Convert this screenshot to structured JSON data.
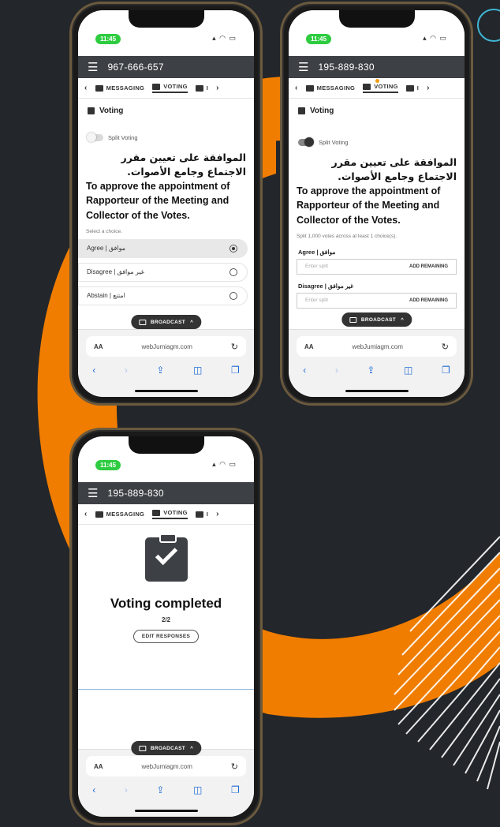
{
  "colors": {
    "background": "#23262a",
    "accent_orange": "#f07d00",
    "appbar": "#3d4145",
    "status_green": "#2ecc40"
  },
  "phones": [
    {
      "status_time": "11:45",
      "meeting_id": "967-666-657",
      "tabs": {
        "messaging": "MESSAGING",
        "voting": "VOTING",
        "docs": "I"
      },
      "section_title": "Voting",
      "split_voting": "Split Voting",
      "question_ar": "الموافقة على تعيين مقرر الاجتماع وجامع الأصوات.",
      "question_en": "To approve the appointment of Rapporteur of the Meeting and Collector of the Votes.",
      "hint": "Select a choice.",
      "choices": [
        {
          "label": "Agree | موافق",
          "selected": true
        },
        {
          "label": "Disagree | غير موافق",
          "selected": false
        },
        {
          "label": "Abstain | امتنع",
          "selected": false
        }
      ],
      "broadcast": "BROADCAST",
      "url": "webJumiagm.com",
      "aa": "AA"
    },
    {
      "status_time": "11:45",
      "meeting_id": "195-889-830",
      "tabs": {
        "messaging": "MESSAGING",
        "voting": "VOTING",
        "docs": "I"
      },
      "section_title": "Voting",
      "split_voting": "Split Voting",
      "question_ar": "الموافقة على تعيين مقرر الاجتماع وجامع الأصوات.",
      "question_en": "To approve the appointment of Rapporteur of the Meeting and Collector of the Votes.",
      "hint": "Split 1,000 votes across at least 1 choice(s).",
      "splits": [
        {
          "label": "Agree | موافق",
          "placeholder": "Enter split",
          "action": "ADD REMAINING"
        },
        {
          "label": "Disagree | غير موافق",
          "placeholder": "Enter split",
          "action": "ADD REMAINING"
        }
      ],
      "broadcast": "BROADCAST",
      "url": "webJumiagm.com",
      "aa": "AA"
    },
    {
      "status_time": "11:45",
      "meeting_id": "195-889-830",
      "tabs": {
        "messaging": "MESSAGING",
        "voting": "VOTING",
        "docs": "I"
      },
      "done_title": "Voting completed",
      "done_count": "2/2",
      "edit_label": "EDIT RESPONSES",
      "broadcast": "BROADCAST",
      "url": "webJumiagm.com",
      "aa": "AA"
    }
  ]
}
